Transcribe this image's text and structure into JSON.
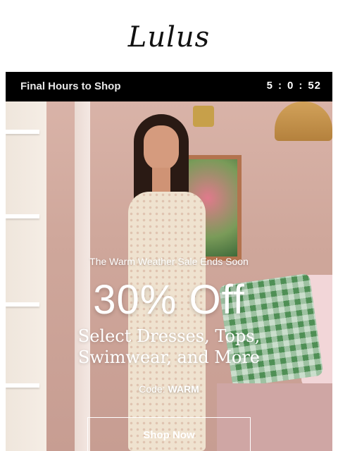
{
  "header": {
    "logo_text": "Lulus"
  },
  "countdown": {
    "label": "Final Hours to Shop",
    "hours": "5",
    "minutes": "0",
    "seconds": "52",
    "separator": ":"
  },
  "hero": {
    "tagline": "The Warm Weather Sale Ends Soon",
    "headline": "30% Off",
    "subhead_line1": "Select Dresses, Tops,",
    "subhead_line2": "Swimwear, and More",
    "code_label": "Code:",
    "code_value": "WARM",
    "cta_label": "Shop Now"
  },
  "colors": {
    "countdown_bg": "#000000",
    "hero_wall": "#d9b3a8",
    "text": "#ffffff"
  }
}
